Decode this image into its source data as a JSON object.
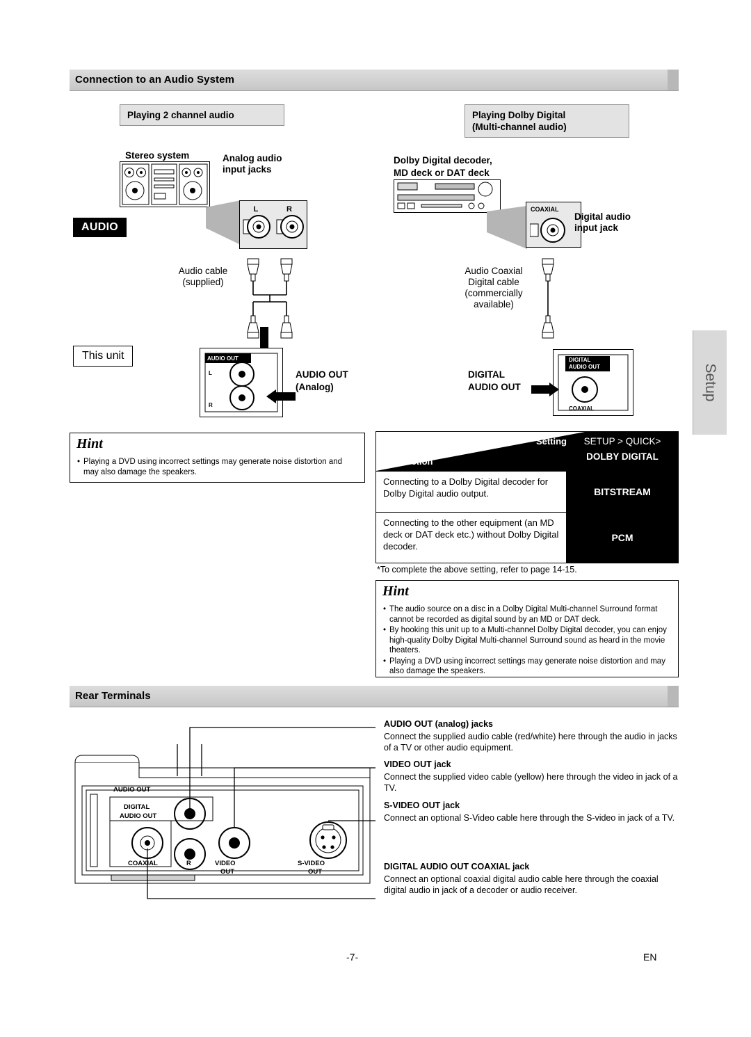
{
  "sections": {
    "audio_system": "Connection to an Audio System",
    "rear_terminals": "Rear Terminals"
  },
  "left_column": {
    "subhead": "Playing 2 channel audio",
    "stereo_system_label": "Stereo system",
    "analog_audio_input_jacks": "Analog audio\ninput jacks",
    "jack_l": "L",
    "jack_r": "R",
    "audio_badge": "AUDIO",
    "this_unit_badge": "This unit",
    "audio_cable": "Audio cable\n(supplied)",
    "audio_out_box_label": "AUDIO OUT",
    "audio_out_l": "L",
    "audio_out_r": "R",
    "audio_out_callout": "AUDIO OUT",
    "audio_out_callout2": "(Analog)"
  },
  "right_column": {
    "subhead_line1": "Playing Dolby Digital",
    "subhead_line2": "(Multi-channel audio)",
    "decoder_label_line1": "Dolby  Digital  decoder,",
    "decoder_label_line2": "MD deck or DAT deck",
    "coaxial_label": "COAXIAL",
    "digital_audio_input_jack": "Digital audio\ninput jack",
    "cable_label": "Audio Coaxial\nDigital cable\n(commercially\navailable)",
    "digital_audio_out_callout_l1": "DIGITAL",
    "digital_audio_out_callout_l2": "AUDIO OUT",
    "unit_box_l1": "DIGITAL",
    "unit_box_l2": "AUDIO OUT",
    "unit_box_coaxial": "COAXIAL"
  },
  "hint_left": {
    "title": "Hint",
    "items": [
      "Playing a DVD using incorrect settings may generate noise distortion and may also damage the speakers."
    ]
  },
  "table": {
    "header_setting": "Setting",
    "header_connection": "Connection",
    "header_right_l1": "SETUP > QUICK>",
    "header_right_l2": "DOLBY DIGITAL",
    "rows": [
      {
        "connection": "Connecting to a Dolby Digital decoder for Dolby Digital audio output.",
        "setting": "BITSTREAM"
      },
      {
        "connection": "Connecting to the other equipment (an MD deck or DAT deck etc.) without Dolby Digital decoder.",
        "setting": "PCM"
      }
    ],
    "note": "*To complete the above setting, refer to page 14-15."
  },
  "hint_right": {
    "title": "Hint",
    "items": [
      "The audio source on a disc in a Dolby Digital Multi-channel Surround format cannot be recorded as digital sound by an MD or DAT deck.",
      "By hooking this unit up to a Multi-channel Dolby Digital decoder, you can enjoy high-quality Dolby Digital Multi-channel Surround sound as heard in the movie theaters.",
      "Playing a DVD using incorrect settings may generate noise distortion and may also damage the speakers."
    ]
  },
  "side_tab": {
    "label": "Setup"
  },
  "rear_panel": {
    "audio_out": "AUDIO OUT",
    "digital": "DIGITAL",
    "digital_audio_out": "AUDIO OUT",
    "coaxial": "COAXIAL",
    "r": "R",
    "video_l1": "VIDEO",
    "video_l2": "OUT",
    "svideo_l1": "S-VIDEO",
    "svideo_l2": "OUT"
  },
  "rear_descriptions": [
    {
      "heading": "AUDIO OUT (analog) jacks",
      "body": "Connect the supplied audio cable (red/white) here through the audio in jacks of a TV or other audio equipment."
    },
    {
      "heading": "VIDEO OUT jack",
      "body": "Connect the supplied video cable (yellow) here through the video in jack of a TV."
    },
    {
      "heading": "S-VIDEO OUT jack",
      "body": "Connect an optional S-Video cable here through the S-video in jack of a TV."
    },
    {
      "heading": "DIGITAL AUDIO OUT COAXIAL jack",
      "body": "Connect an optional coaxial digital audio cable here through the coaxial digital audio in jack of a decoder or audio receiver."
    }
  ],
  "footer": {
    "page": "-7-",
    "lang": "EN"
  }
}
